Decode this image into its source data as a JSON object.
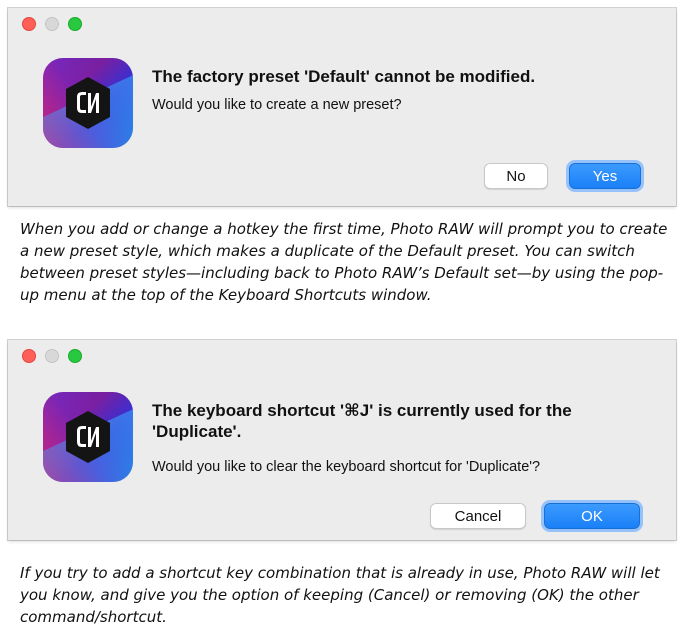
{
  "dialog1": {
    "title": "The factory preset 'Default' cannot be modified.",
    "message": "Would you like to create a new preset?",
    "buttons": {
      "secondary": "No",
      "primary": "Yes"
    },
    "icon": "on1-photo-raw-app-icon",
    "icon_text": "ON1"
  },
  "caption1": "When you add or change a hotkey the first time, Photo RAW will prompt you to create a new preset style, which makes a duplicate of the Default preset. You can switch between preset styles—including back to Photo RAW’s Default set—by using the pop-up menu at the top of the Keyboard Shortcuts window.",
  "dialog2": {
    "title": "The keyboard shortcut '⌘J' is currently used for the 'Duplicate'.",
    "message": "Would you like to clear the keyboard shortcut for 'Duplicate'?",
    "buttons": {
      "secondary": "Cancel",
      "primary": "OK"
    },
    "icon": "on1-photo-raw-app-icon",
    "icon_text": "ON1"
  },
  "caption2": "If you try to add a shortcut key combination that is already in use, Photo RAW will let you know, and give you the option of keeping (Cancel) or removing (OK) the other command/shortcut.",
  "colors": {
    "dialog_bg": "#ececec",
    "close": "#ff5f57",
    "minimize_disabled": "#d8d8d8",
    "zoom": "#28c840",
    "primary_button": "#1a80f7"
  }
}
